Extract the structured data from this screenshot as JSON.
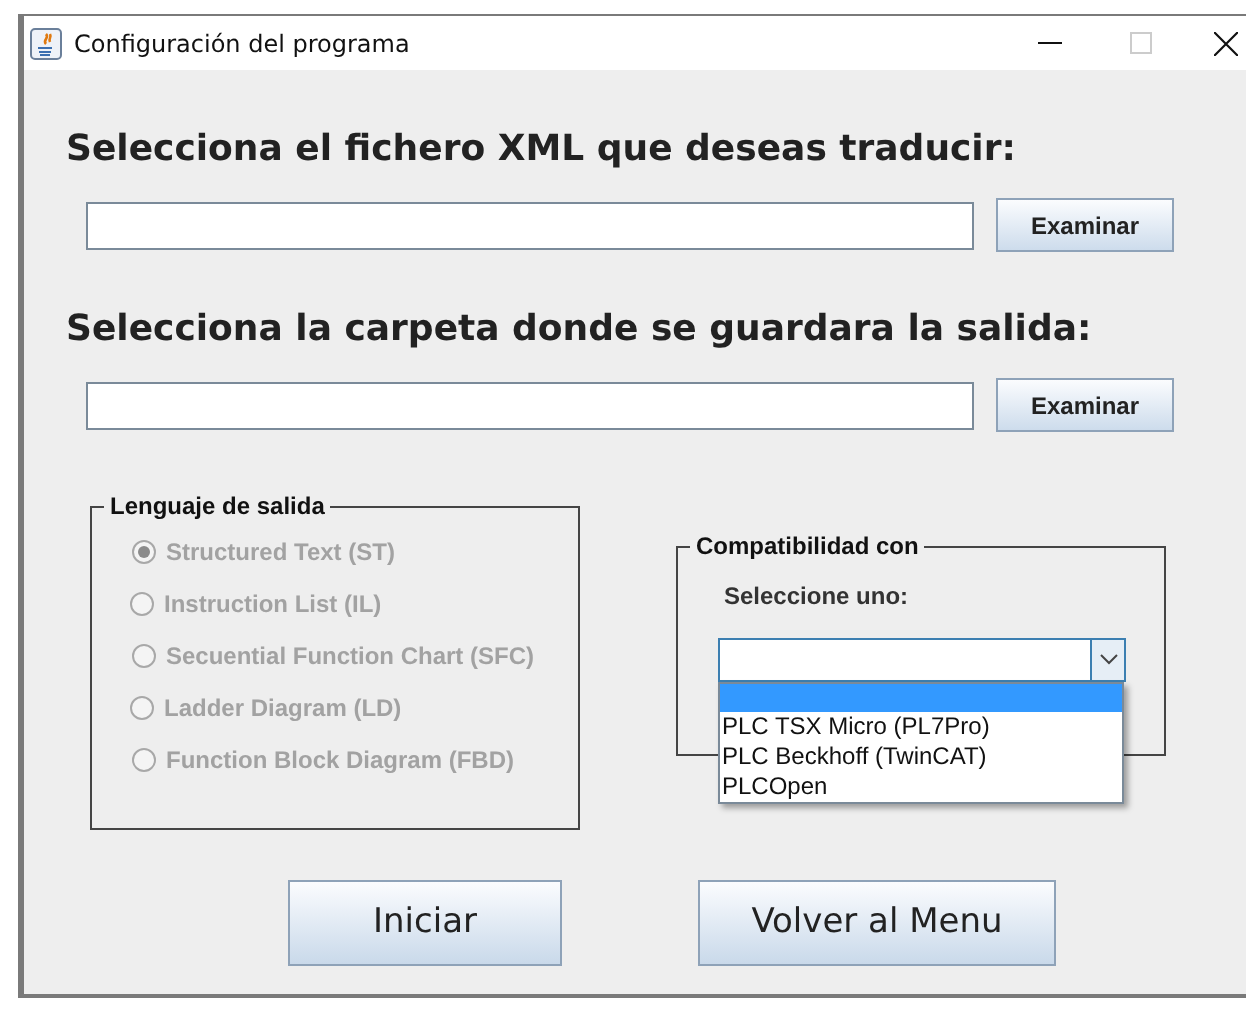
{
  "window": {
    "title": "Configuración del programa",
    "controls": [
      {
        "kind": "minimize",
        "disabled": false
      },
      {
        "kind": "maximize",
        "disabled": true
      },
      {
        "kind": "close",
        "disabled": false
      }
    ]
  },
  "sections": [
    {
      "heading": "Selecciona el fichero XML que deseas traducir:",
      "button": "Examinar"
    },
    {
      "heading": "Selecciona la carpeta donde se guardara la salida:",
      "button": "Examinar"
    }
  ],
  "output_language": {
    "legend": "Lenguaje de salida",
    "disabled": true,
    "options": [
      {
        "label": "Structured Text (ST)",
        "selected": true
      },
      {
        "label": "Instruction List (IL)",
        "selected": false
      },
      {
        "label": "Secuential Function Chart (SFC)",
        "selected": false
      },
      {
        "label": "Ladder Diagram (LD)",
        "selected": false
      },
      {
        "label": "Function Block Diagram (FBD)",
        "selected": false
      }
    ]
  },
  "compatibility": {
    "legend": "Compatibilidad con",
    "prompt": "Seleccione uno:",
    "dropdown": {
      "expanded": true,
      "options": [
        {
          "kind": "blank",
          "selected": true
        },
        {
          "kind": "item",
          "label": "PLC TSX Micro (PL7Pro)",
          "selected": false
        },
        {
          "kind": "item",
          "label": "PLC Beckhoff (TwinCAT)",
          "selected": false
        },
        {
          "kind": "item",
          "label": "PLCOpen",
          "selected": false
        }
      ]
    }
  },
  "buttons": [
    "Iniciar",
    "Volver al Menu"
  ]
}
